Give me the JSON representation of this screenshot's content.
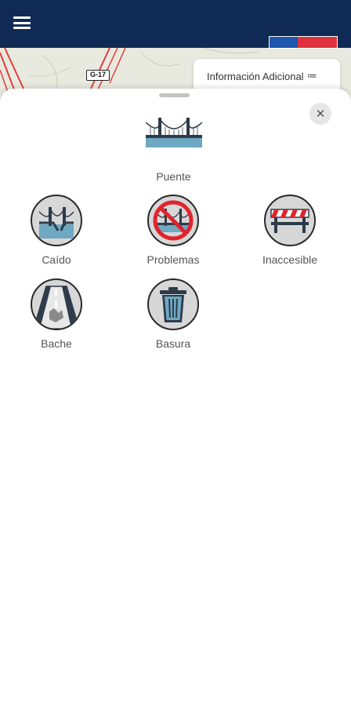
{
  "header": {
    "menu_icon": "hamburger-menu-icon",
    "brand_colors": {
      "navy": "#0e2a55",
      "flag_blue": "#1f56b0",
      "flag_red": "#e0323e"
    }
  },
  "map": {
    "road_label": "G-17"
  },
  "info_button": {
    "label": "Información Adicional",
    "icon": "≔"
  },
  "sheet": {
    "close_icon": "✕",
    "selected": {
      "label": "Puente",
      "icon": "bridge-icon"
    },
    "options": [
      {
        "label": "Caído",
        "icon": "fallen-bridge-icon"
      },
      {
        "label": "Problemas",
        "icon": "prohibited-bridge-icon"
      },
      {
        "label": "Inaccesible",
        "icon": "barrier-icon"
      },
      {
        "label": "Bache",
        "icon": "pothole-road-icon"
      },
      {
        "label": "Basura",
        "icon": "trash-can-icon"
      }
    ]
  }
}
